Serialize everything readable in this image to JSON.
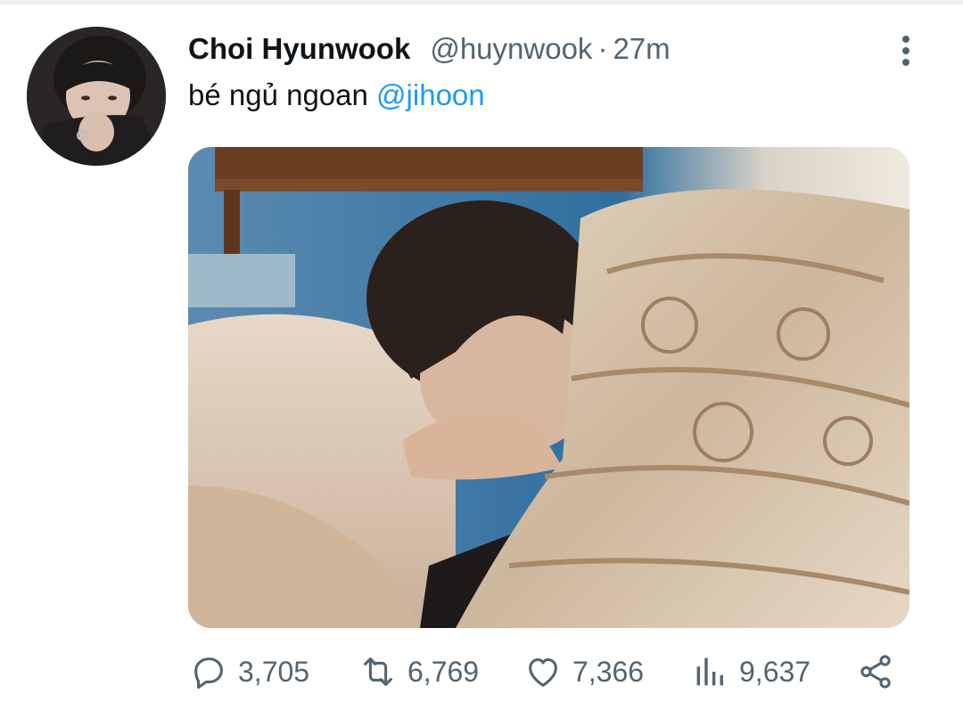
{
  "tweet": {
    "display_name": "Choi Hyunwook",
    "handle": "@huynwook",
    "separator": "·",
    "time": "27m",
    "text": "bé ngủ ngoan ",
    "mention": "@jihoon"
  },
  "actions": {
    "replies": "3,705",
    "retweets": "6,769",
    "likes": "7,366",
    "views": "9,637"
  },
  "icons": {
    "more": "more-vertical-icon",
    "reply": "comment-icon",
    "retweet": "retweet-icon",
    "like": "heart-icon",
    "views": "views-chart-icon",
    "share": "share-icon"
  },
  "colors": {
    "text": "#0f1419",
    "secondary": "#536471",
    "link": "#1d9bf0"
  }
}
